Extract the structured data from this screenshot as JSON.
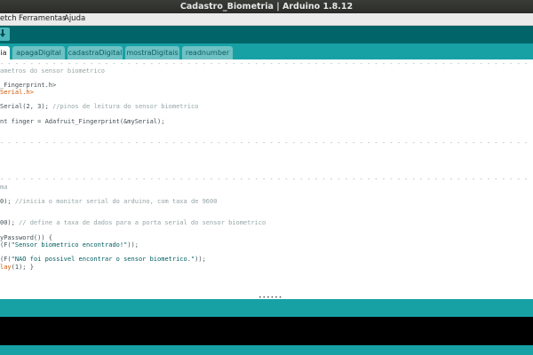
{
  "window": {
    "title": "Cadastro_Biometria | Arduino 1.8.12"
  },
  "menu": {
    "items": [
      "etch",
      "Ferramentas",
      "Ajuda"
    ]
  },
  "tabs": [
    {
      "label": "ia",
      "active": true
    },
    {
      "label": "apagaDigital",
      "active": false
    },
    {
      "label": "cadastraDigital",
      "active": false
    },
    {
      "label": "mostraDigitais",
      "active": false
    },
    {
      "label": "readnumber",
      "active": false
    }
  ],
  "code": {
    "sep": "- - - - - - - - - - - - - - - - - - - - - - - - - - - - - - - - - - - - - - - - - - - - - - - - - - - - - - - - - - - - - - - - - - - - - - -",
    "l1": "ametros do sensor biometrico",
    "l2": "_Fingerprint.h>",
    "l3": "Serial.h>",
    "l4a": "Serial(2, 3);",
    "l4b": " //pinos de leitura do sensor biometrico",
    "l5": "nt finger = Adafruit_Fingerprint(&mySerial);",
    "l6": "ma",
    "l7a": "0);",
    "l7b": " //inicia o monitor serial do arduino, com taxa de 9600",
    "l8a": "00);",
    "l8b": " // define a taxa de dados para a porta serial do sensor biometrico",
    "l9": "yPassword()) {",
    "l10a": "(F(",
    "l10b": "\"Sensor biometrico encontrado!\"",
    "l10c": "));",
    "l11a": "(F(",
    "l11b": "\"NAO foi possivel encontrar o sensor biometrico.\"",
    "l11c": "));",
    "l12a": "lay",
    "l12b": "(1); }"
  },
  "colors": {
    "toolbar": "#006468",
    "tabstrip": "#17a1a5",
    "console": "#000000",
    "comment": "#95a5a6",
    "keyword": "#d35400"
  }
}
